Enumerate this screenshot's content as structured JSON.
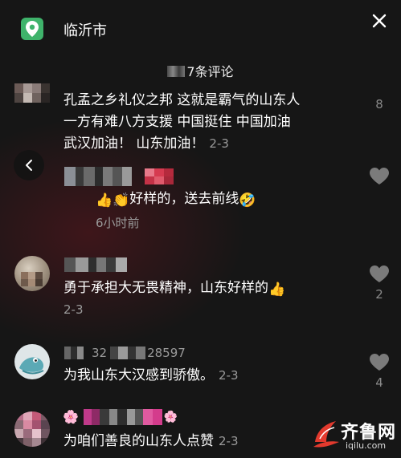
{
  "location": {
    "name": "临沂市"
  },
  "header": {
    "title": "7条评论"
  },
  "comments": [
    {
      "text_line1": "孔孟之乡礼仪之邦 这就是霸气的山东人",
      "text_line2": "一方有难八方支援 中国挺住 中国加油",
      "text_line3": "武汉加油！ 山东加油！",
      "date": "2-3",
      "likes": "8"
    },
    {
      "reply_text": "好样的，送去前线",
      "time": "6小时前"
    },
    {
      "text": "勇于承担大无畏精神，山东好样的",
      "date": "2-3",
      "likes": "2"
    },
    {
      "user": "28597",
      "user_prefix": "32",
      "text": "为我山东大汉感到骄傲。",
      "date": "2-3",
      "likes": "4"
    },
    {
      "text": "为咱们善良的山东人点赞",
      "date": "2-3"
    }
  ],
  "watermark": {
    "title": "齐鲁网",
    "url": "iqilu.com"
  },
  "icons": {
    "location": "map-pin-icon",
    "close": "close-icon",
    "back": "chevron-left-icon",
    "like": "heart-icon"
  }
}
